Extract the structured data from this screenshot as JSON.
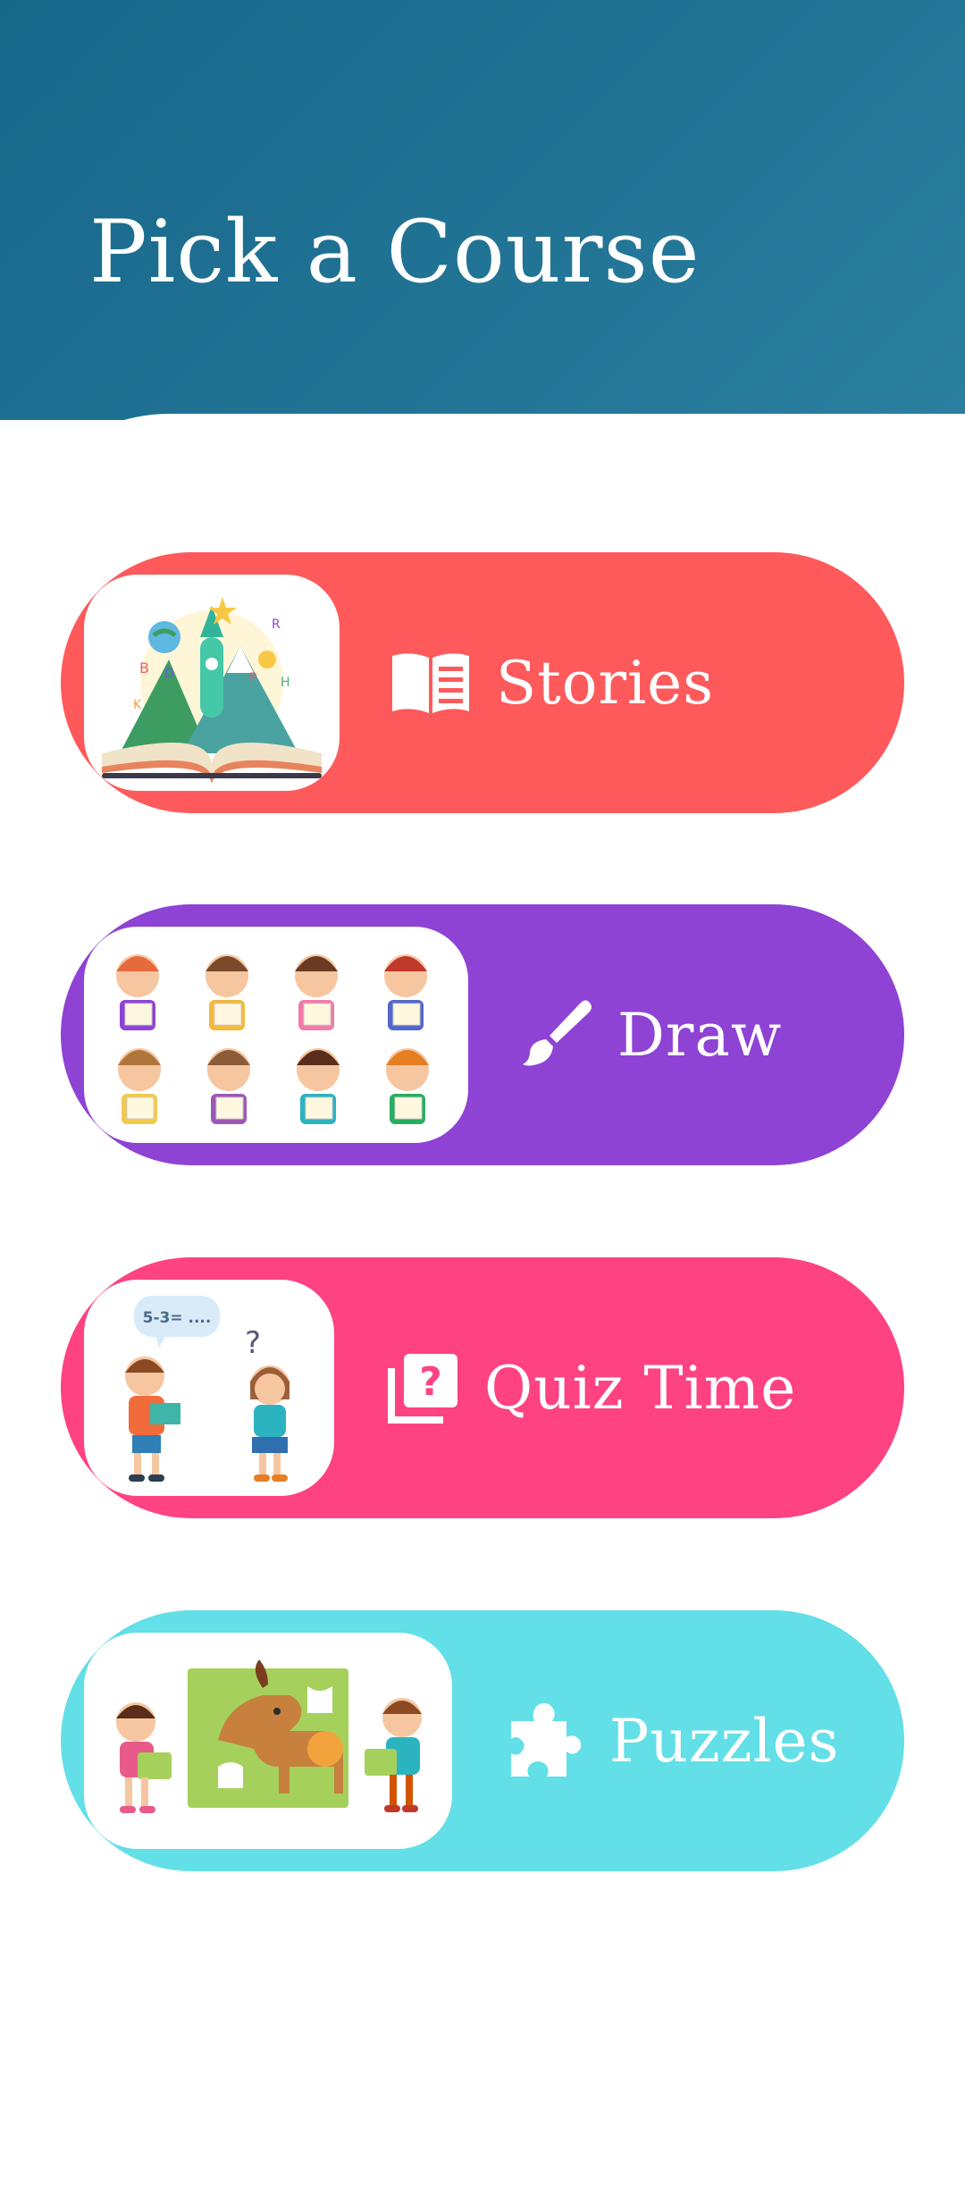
{
  "header": {
    "title": "Pick a Course"
  },
  "colors": {
    "header": "#17678a",
    "stories": "#fe5a5b",
    "draw": "#8e43d4",
    "quiz": "#fe4282",
    "puzzles": "#62dfe7"
  },
  "courses": [
    {
      "label": "Stories",
      "icon": "book-icon",
      "image": "open-book-illustration"
    },
    {
      "label": "Draw",
      "icon": "paintbrush-icon",
      "image": "kids-drawings-illustration"
    },
    {
      "label": "Quiz Time",
      "icon": "quiz-icon",
      "image": "kids-quiz-illustration",
      "bubble": "5-3= ....",
      "question_mark": "?"
    },
    {
      "label": "Puzzles",
      "icon": "puzzle-piece-icon",
      "image": "kids-puzzle-illustration"
    }
  ]
}
